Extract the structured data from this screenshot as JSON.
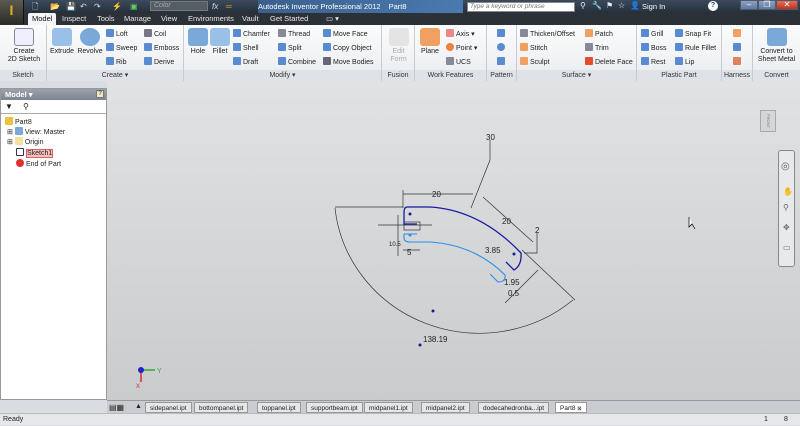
{
  "titlebar": {
    "app_title": "Autodesk Inventor Professional 2012",
    "doc_title": "Part8",
    "color_select": "Color",
    "search_placeholder": "Type a keyword or phrase",
    "sign_in": "Sign In",
    "help": "?"
  },
  "tabs": [
    "Model",
    "Inspect",
    "Tools",
    "Manage",
    "View",
    "Environments",
    "Vault",
    "Get Started"
  ],
  "ribbon": {
    "sketch": {
      "label": "Sketch",
      "create_2d": "Create\n2D Sketch",
      "create_2d_l1": "Create",
      "create_2d_l2": "2D Sketch"
    },
    "create": {
      "label": "Create ▾",
      "extrude": "Extrude",
      "revolve": "Revolve",
      "loft": "Loft",
      "sweep": "Sweep",
      "rib": "Rib",
      "coil": "Coil",
      "emboss": "Emboss",
      "derive": "Derive"
    },
    "modify": {
      "label": "Modify ▾",
      "hole": "Hole",
      "fillet": "Fillet",
      "chamfer": "Chamfer",
      "shell": "Shell",
      "draft": "Draft",
      "thread": "Thread",
      "split": "Split",
      "combine": "Combine",
      "move_face": "Move Face",
      "copy_object": "Copy Object",
      "move_bodies": "Move Bodies"
    },
    "fusion": {
      "label": "Fusion",
      "edit_form_l1": "Edit",
      "edit_form_l2": "Form"
    },
    "work_features": {
      "label": "Work Features",
      "plane": "Plane",
      "axis": "Axis",
      "point": "Point",
      "ucs": "UCS"
    },
    "pattern": {
      "label": "Pattern"
    },
    "surface": {
      "label": "Surface ▾",
      "thicken": "Thicken/Offset",
      "stitch": "Stitch",
      "sculpt": "Sculpt",
      "patch": "Patch",
      "trim": "Trim",
      "delete_face": "Delete Face"
    },
    "plastic": {
      "label": "Plastic Part",
      "grill": "Grill",
      "boss": "Boss",
      "rest": "Rest",
      "snap_fit": "Snap Fit",
      "rule_fillet": "Rule Fillet",
      "lip": "Lip"
    },
    "harness": {
      "label": "Harness"
    },
    "convert": {
      "label": "Convert",
      "l1": "Convert to",
      "l2": "Sheet Metal"
    }
  },
  "browser": {
    "title": "Model ▾",
    "items": [
      "Part8",
      "View: Master",
      "Origin",
      "Sketch1",
      "End of Part"
    ]
  },
  "viewcube": "FRONT",
  "sketch_dims": {
    "angle": "30",
    "top_len": "20",
    "diag_len": "20",
    "small_2": "2",
    "d385": "3.85",
    "d195": "1.95",
    "d05": "0.5",
    "radius": "138.19",
    "left_w": "5",
    "left_mid": "10.5"
  },
  "triad": {
    "x": "X",
    "y": "Y"
  },
  "doc_tabs": [
    "sidepanel.ipt",
    "bottompanel.ipt",
    "toppanel.ipt",
    "supportbeam.ipt",
    "midpanel1.ipt",
    "midpanel2.ipt",
    "dodecahedronba...ipt",
    "Part8"
  ],
  "status": {
    "text": "Ready",
    "n1": "1",
    "n2": "8"
  },
  "colors": {
    "sketch_dark": "#1a1aa0",
    "sketch_light": "#2a8fe8",
    "accent": "#e8b020"
  }
}
